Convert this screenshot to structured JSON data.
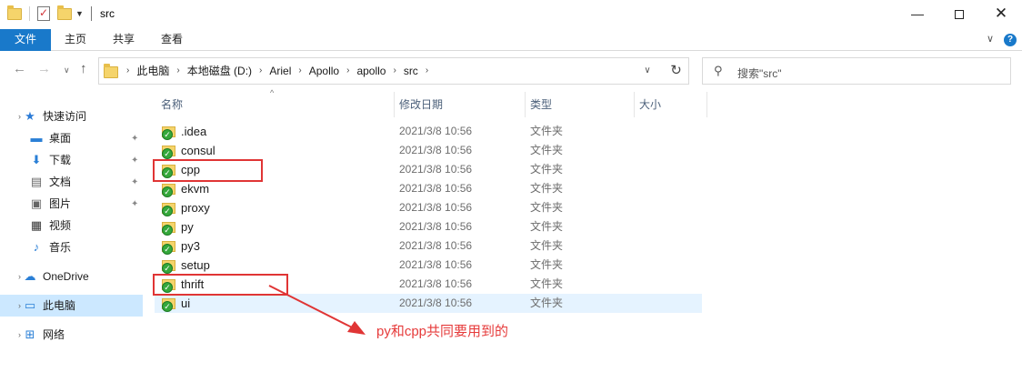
{
  "window": {
    "title": "src",
    "minimize_glyph": "—",
    "close_glyph": "✕"
  },
  "ribbon": {
    "tabs": [
      {
        "label": "文件",
        "active": true
      },
      {
        "label": "主页"
      },
      {
        "label": "共享"
      },
      {
        "label": "查看"
      }
    ],
    "help_glyph": "?"
  },
  "address": {
    "breadcrumbs": [
      "此电脑",
      "本地磁盘 (D:)",
      "Ariel",
      "Apollo",
      "apollo",
      "src"
    ],
    "search_placeholder": "搜索\"src\""
  },
  "nav_pane": {
    "items": [
      {
        "label": "快速访问",
        "icon": "star-icon",
        "pinned": false
      },
      {
        "label": "桌面",
        "icon": "desktop-icon",
        "pinned": true
      },
      {
        "label": "下载",
        "icon": "download-icon",
        "pinned": true
      },
      {
        "label": "文档",
        "icon": "document-icon",
        "pinned": true
      },
      {
        "label": "图片",
        "icon": "picture-icon",
        "pinned": true
      },
      {
        "label": "视频",
        "icon": "video-icon",
        "pinned": false
      },
      {
        "label": "音乐",
        "icon": "music-icon",
        "pinned": false
      },
      {
        "label": "OneDrive",
        "icon": "cloud-icon",
        "pinned": false
      },
      {
        "label": "此电脑",
        "icon": "computer-icon",
        "pinned": false,
        "selected": true
      },
      {
        "label": "网络",
        "icon": "network-icon",
        "pinned": false
      }
    ]
  },
  "columns": {
    "name": "名称",
    "date": "修改日期",
    "type": "类型",
    "size": "大小"
  },
  "files": [
    {
      "name": ".idea",
      "date": "2021/3/8 10:56",
      "type": "文件夹"
    },
    {
      "name": "consul",
      "date": "2021/3/8 10:56",
      "type": "文件夹"
    },
    {
      "name": "cpp",
      "date": "2021/3/8 10:56",
      "type": "文件夹"
    },
    {
      "name": "ekvm",
      "date": "2021/3/8 10:56",
      "type": "文件夹"
    },
    {
      "name": "proxy",
      "date": "2021/3/8 10:56",
      "type": "文件夹"
    },
    {
      "name": "py",
      "date": "2021/3/8 10:56",
      "type": "文件夹"
    },
    {
      "name": "py3",
      "date": "2021/3/8 10:56",
      "type": "文件夹"
    },
    {
      "name": "setup",
      "date": "2021/3/8 10:56",
      "type": "文件夹"
    },
    {
      "name": "thrift",
      "date": "2021/3/8 10:56",
      "type": "文件夹"
    },
    {
      "name": "ui",
      "date": "2021/3/8 10:56",
      "type": "文件夹",
      "hovered": true
    }
  ],
  "annotation": {
    "text": "py和cpp共同要用到的",
    "color": "#e03535"
  },
  "colors": {
    "accent": "#1979ca",
    "selection": "#cce8ff",
    "hover": "#e5f3ff",
    "folder": "#f5d46b",
    "sync_ok": "#35a83b"
  }
}
